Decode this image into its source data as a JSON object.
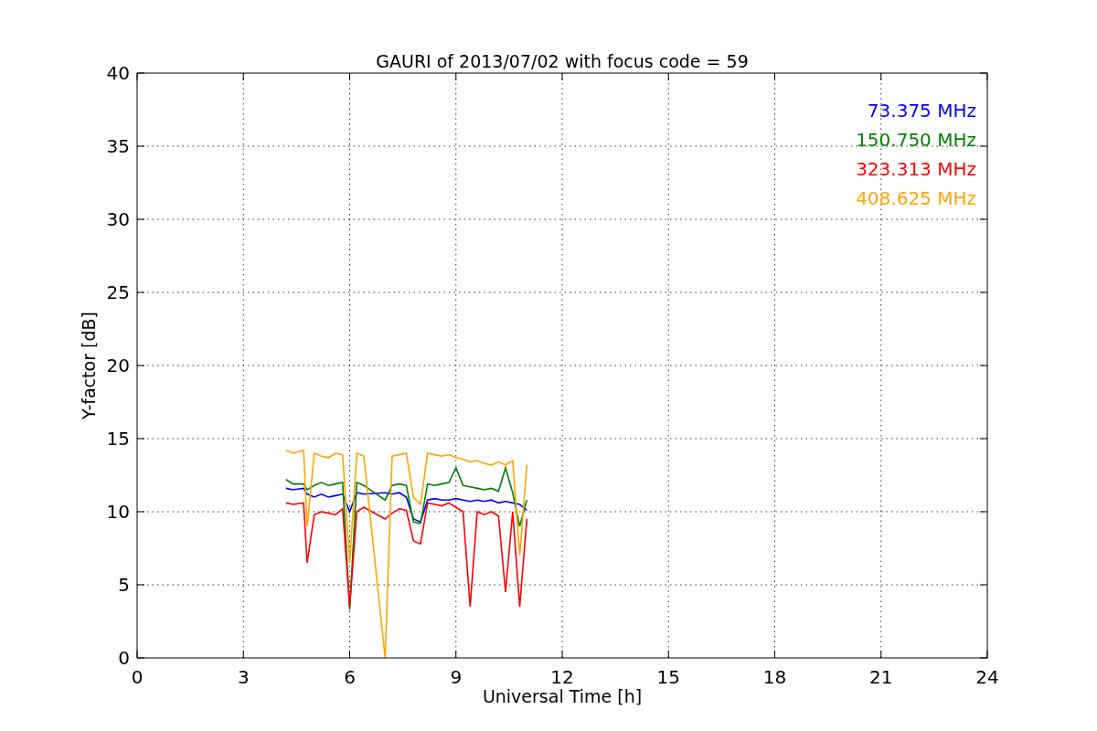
{
  "figure": {
    "chart_data": {
      "type": "line",
      "title": "GAURI of 2013/07/02 with focus code = 59",
      "xlabel": "Universal Time [h]",
      "ylabel": "Y-factor [dB]",
      "xlim": [
        0,
        24
      ],
      "ylim": [
        0,
        40
      ],
      "xticks": [
        0,
        3,
        6,
        9,
        12,
        15,
        18,
        21,
        24
      ],
      "yticks": [
        0,
        5,
        10,
        15,
        20,
        25,
        30,
        35,
        40
      ],
      "grid": true,
      "x": [
        4.2,
        4.4,
        4.7,
        4.8,
        5.0,
        5.2,
        5.4,
        5.6,
        5.8,
        6.0,
        6.2,
        6.4,
        7.0,
        7.2,
        7.4,
        7.6,
        7.8,
        8.0,
        8.2,
        8.4,
        8.6,
        8.8,
        9.0,
        9.2,
        9.4,
        9.6,
        9.8,
        10.0,
        10.2,
        10.4,
        10.6,
        10.8,
        11.0
      ],
      "series": [
        {
          "name": "73.375 MHz",
          "color": "#0000ff",
          "values": [
            11.6,
            11.5,
            11.6,
            11.2,
            11.0,
            11.2,
            11.0,
            11.1,
            11.2,
            10.0,
            11.3,
            11.2,
            11.3,
            11.2,
            11.3,
            11.0,
            9.5,
            9.3,
            10.8,
            10.9,
            10.8,
            10.8,
            10.9,
            10.8,
            10.7,
            10.8,
            10.7,
            10.8,
            10.6,
            10.7,
            10.6,
            10.5,
            10.1
          ]
        },
        {
          "name": "150.750 MHz",
          "color": "#008000",
          "values": [
            12.2,
            11.9,
            11.9,
            11.5,
            11.8,
            12.0,
            11.8,
            11.9,
            12.0,
            3.3,
            12.0,
            11.8,
            10.8,
            11.8,
            11.9,
            11.8,
            9.3,
            9.2,
            11.9,
            11.8,
            11.9,
            12.0,
            13.0,
            11.8,
            11.7,
            11.6,
            11.5,
            11.6,
            11.4,
            13.0,
            11.3,
            9.0,
            10.8
          ]
        },
        {
          "name": "323.313 MHz",
          "color": "#ff0000",
          "values": [
            10.6,
            10.5,
            10.6,
            6.5,
            9.8,
            10.0,
            9.9,
            9.8,
            10.2,
            3.5,
            10.0,
            10.3,
            9.5,
            9.9,
            10.2,
            10.1,
            8.0,
            7.8,
            10.6,
            10.5,
            10.4,
            10.6,
            10.3,
            10.0,
            3.5,
            10.0,
            9.8,
            10.0,
            9.7,
            4.5,
            10.0,
            3.5,
            9.5
          ]
        },
        {
          "name": "408.625 MHz",
          "color": "#ffa500",
          "values": [
            14.2,
            14.0,
            14.2,
            9.0,
            14.0,
            13.8,
            13.7,
            14.0,
            13.9,
            6.5,
            14.0,
            13.8,
            0.0,
            13.8,
            13.9,
            14.0,
            11.0,
            10.5,
            14.0,
            13.9,
            13.8,
            13.9,
            13.7,
            13.6,
            13.4,
            13.5,
            13.3,
            13.2,
            13.4,
            13.2,
            13.5,
            7.0,
            13.2
          ]
        }
      ]
    }
  }
}
